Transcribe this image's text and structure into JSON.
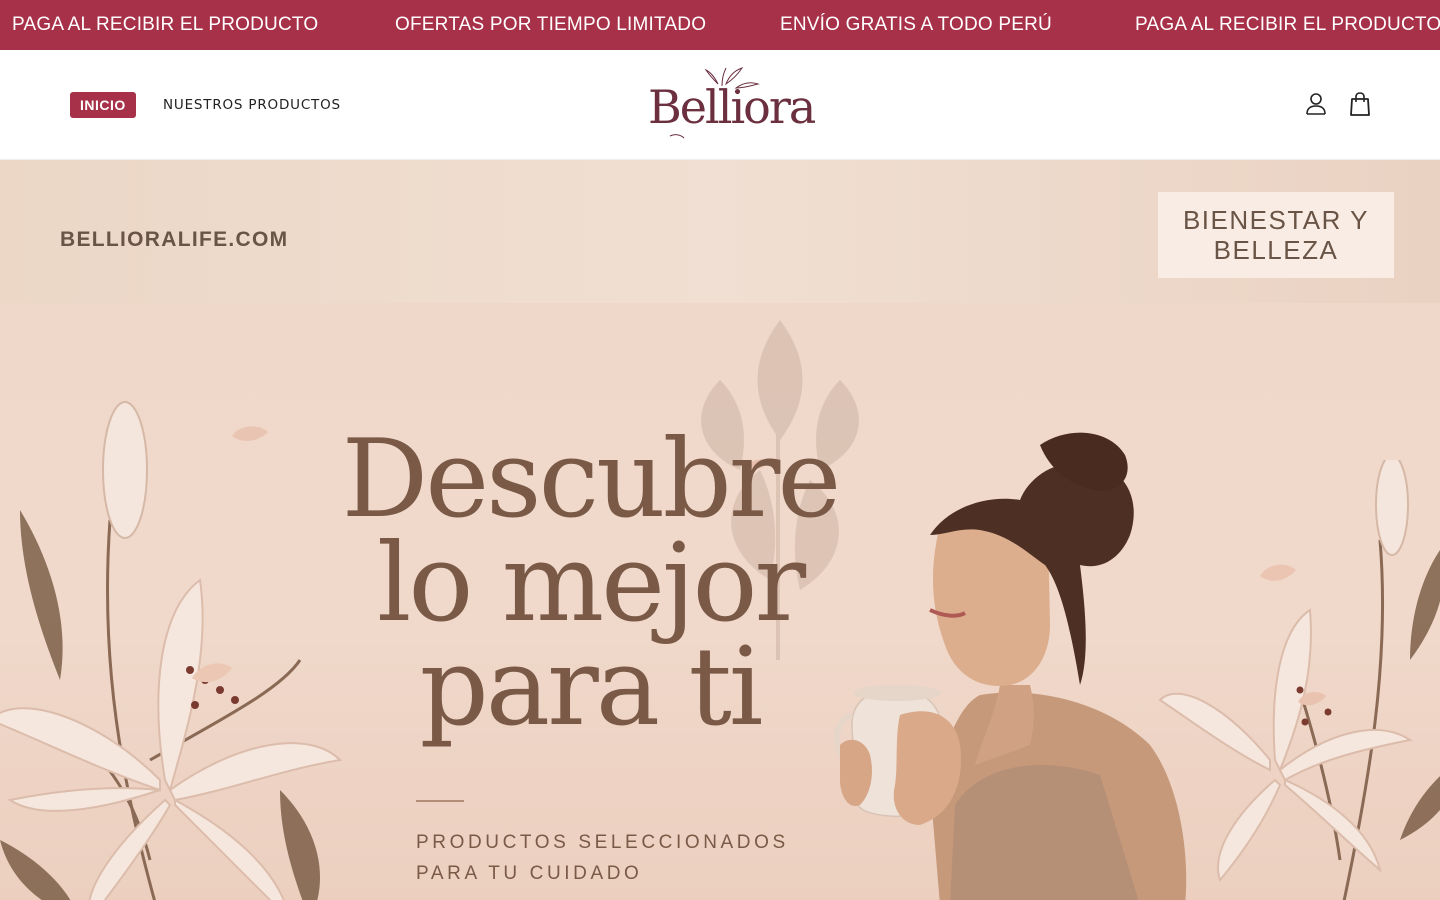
{
  "announcement": {
    "items": [
      "PAGA AL RECIBIR EL PRODUCTO",
      "OFERTAS POR TIEMPO LIMITADO",
      "ENVÍO GRATIS A TODO PERÚ",
      "PAGA AL RECIBIR EL PRODUCTO"
    ],
    "background_color": "#a8314a"
  },
  "header": {
    "nav": {
      "home_label": "INICIO",
      "products_label": "NUESTROS PRODUCTOS"
    },
    "logo_text": "Belliora",
    "icons": [
      "account-icon",
      "cart-icon"
    ],
    "accent_color": "#a8314a"
  },
  "hero": {
    "domain": "BELLIORALIFE.COM",
    "tag_line1": "BIENESTAR Y",
    "tag_line2": "BELLEZA",
    "headline": [
      "Descubre",
      "lo mejor",
      "para ti"
    ],
    "subline1": "PRODUCTOS SELECCIONADOS",
    "subline2": "PARA TU CUIDADO",
    "text_color": "#7a5a47"
  }
}
